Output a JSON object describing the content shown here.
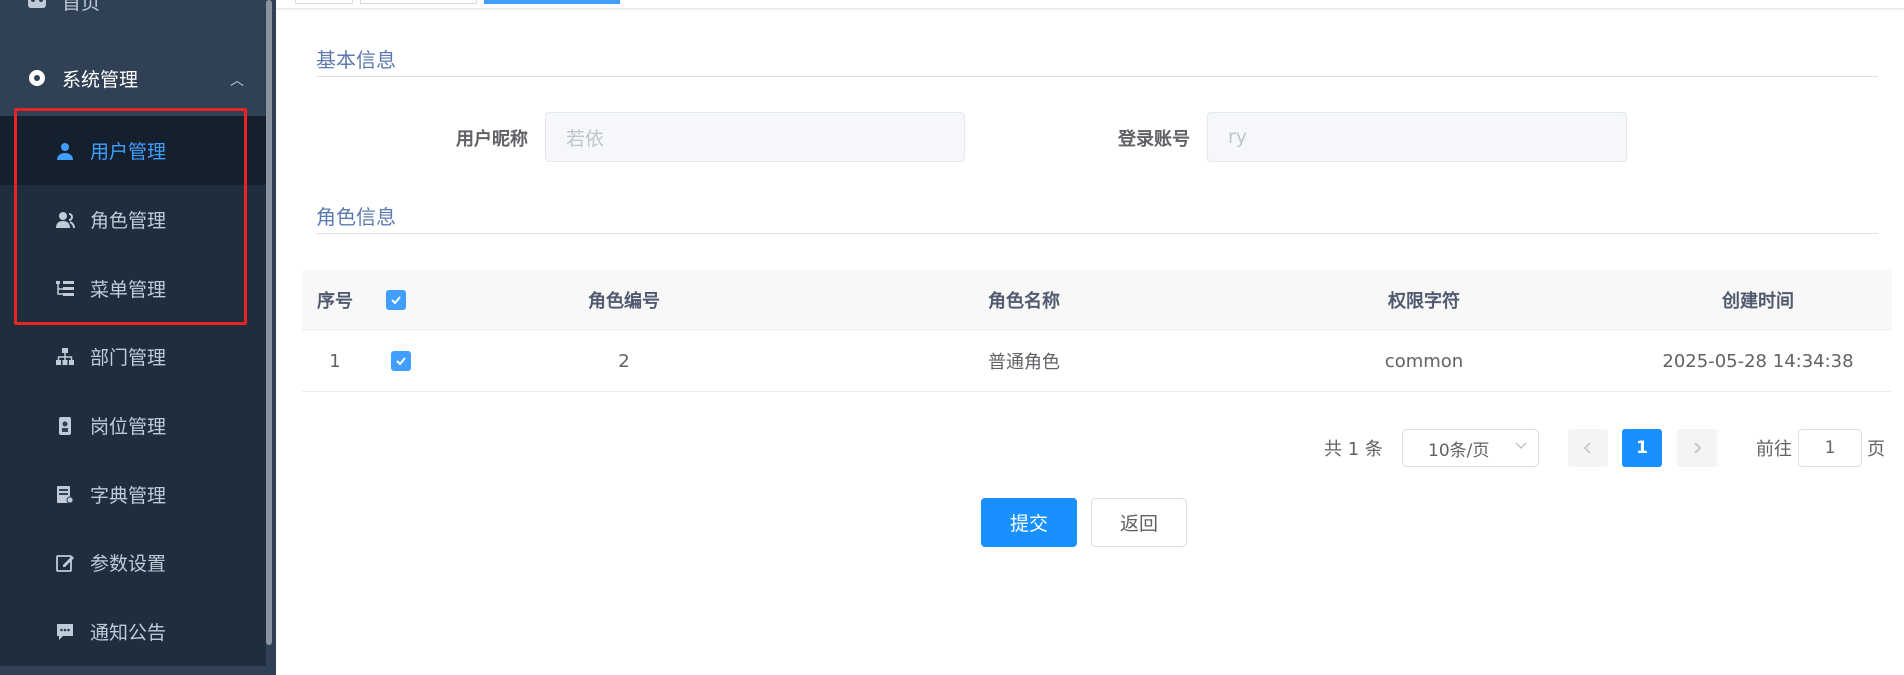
{
  "sidebar": {
    "home_label": "首页",
    "system_label": "系统管理",
    "items": [
      {
        "label": "用户管理",
        "icon": "user-icon",
        "active": true
      },
      {
        "label": "角色管理",
        "icon": "role-icon"
      },
      {
        "label": "菜单管理",
        "icon": "menu-tree-icon"
      },
      {
        "label": "部门管理",
        "icon": "org-tree-icon"
      },
      {
        "label": "岗位管理",
        "icon": "post-icon"
      },
      {
        "label": "字典管理",
        "icon": "dictionary-icon"
      },
      {
        "label": "参数设置",
        "icon": "edit-icon"
      },
      {
        "label": "通知公告",
        "icon": "message-icon"
      }
    ]
  },
  "basic_info": {
    "title": "基本信息",
    "nickname_label": "用户昵称",
    "nickname_value": "若依",
    "account_label": "登录账号",
    "account_value": "ry"
  },
  "role_info": {
    "title": "角色信息",
    "columns": [
      "序号",
      "角色编号",
      "角色名称",
      "权限字符",
      "创建时间"
    ],
    "rows": [
      {
        "index": "1",
        "role_id": "2",
        "role_name": "普通角色",
        "role_key": "common",
        "created": "2025-05-28 14:34:38",
        "checked": true
      }
    ]
  },
  "pagination": {
    "total_text": "共 1 条",
    "page_size": "10条/页",
    "current_page": "1",
    "goto_label": "前往",
    "goto_value": "1",
    "page_suffix": "页"
  },
  "actions": {
    "submit_label": "提交",
    "back_label": "返回"
  },
  "colors": {
    "sidebar_bg": "#304156",
    "accent": "#1890ff",
    "highlight_box": "#e62424"
  }
}
